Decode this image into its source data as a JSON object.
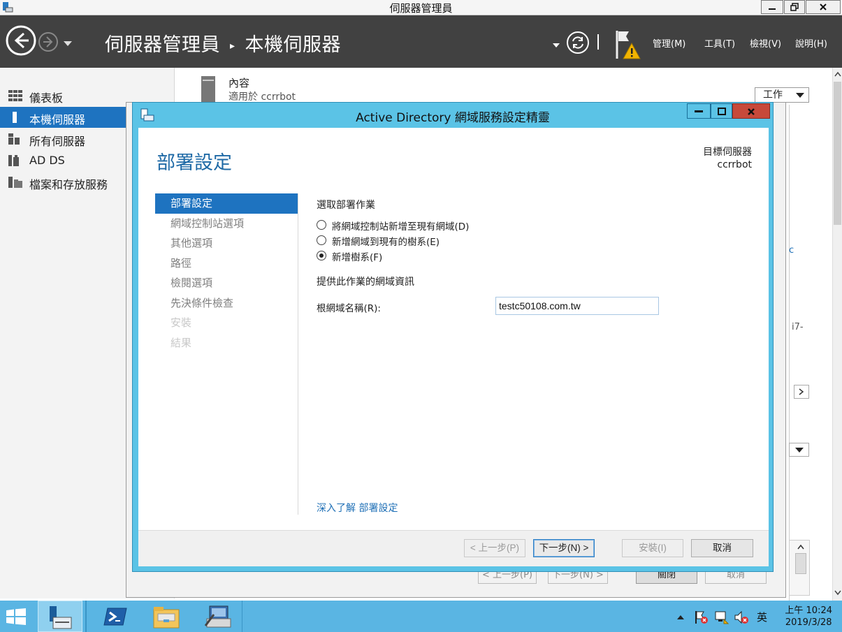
{
  "window": {
    "title": "伺服器管理員",
    "minimize": "minimize",
    "maximize": "maximize",
    "close": "close"
  },
  "header": {
    "breadcrumb_root": "伺服器管理員",
    "breadcrumb_current": "本機伺服器",
    "menus": [
      "管理(M)",
      "工具(T)",
      "檢視(V)",
      "說明(H)"
    ],
    "icons": [
      "back-icon",
      "forward-icon",
      "dropdown-icon",
      "refresh-icon",
      "notification-flag-icon"
    ]
  },
  "sidebar": {
    "items": [
      {
        "label": "儀表板",
        "icon": "dashboard-icon"
      },
      {
        "label": "本機伺服器",
        "icon": "local-server-icon",
        "active": true
      },
      {
        "label": "所有伺服器",
        "icon": "all-servers-icon"
      },
      {
        "label": "AD DS",
        "icon": "ad-ds-icon"
      },
      {
        "label": "檔案和存放服務",
        "icon": "file-storage-icon"
      }
    ]
  },
  "content": {
    "section_title": "內容",
    "section_subtitle": "適用於 ccrrbot",
    "tasks_label": "工作",
    "partial_text_1": "i7-",
    "partial_text_2": "c"
  },
  "under_dialog": {
    "buttons": [
      "< 上一步(P)",
      "下一步(N) >",
      "關閉",
      "取消"
    ]
  },
  "wizard": {
    "title": "Active Directory 網域服務設定精靈",
    "heading": "部署設定",
    "target_label": "目標伺服器",
    "target_server": "ccrrbot",
    "steps": [
      {
        "label": "部署設定",
        "state": "active"
      },
      {
        "label": "網域控制站選項",
        "state": "normal"
      },
      {
        "label": "其他選項",
        "state": "normal"
      },
      {
        "label": "路徑",
        "state": "normal"
      },
      {
        "label": "檢閱選項",
        "state": "normal"
      },
      {
        "label": "先決條件檢查",
        "state": "normal"
      },
      {
        "label": "安裝",
        "state": "disabled"
      },
      {
        "label": "結果",
        "state": "disabled"
      }
    ],
    "operation_label": "選取部署作業",
    "options": [
      {
        "label": "將網域控制站新增至現有網域(D)",
        "checked": false
      },
      {
        "label": "新增網域到現有的樹系(E)",
        "checked": false
      },
      {
        "label": "新增樹系(F)",
        "checked": true
      }
    ],
    "info_label": "提供此作業的網域資訊",
    "root_domain_label": "根網域名稱(R):",
    "root_domain_value": "testc50108.com.tw",
    "learn_more_prefix": "深入了解",
    "learn_more_link": "部署設定",
    "buttons": {
      "previous": "< 上一步(P)",
      "next": "下一步(N) >",
      "install": "安裝(I)",
      "cancel": "取消"
    }
  },
  "taskbar": {
    "time": "上午 10:24",
    "date": "2019/3/28",
    "ime": "英",
    "apps": [
      "start-icon",
      "server-manager-icon",
      "powershell-icon",
      "file-explorer-icon",
      "network-tool-icon"
    ]
  }
}
